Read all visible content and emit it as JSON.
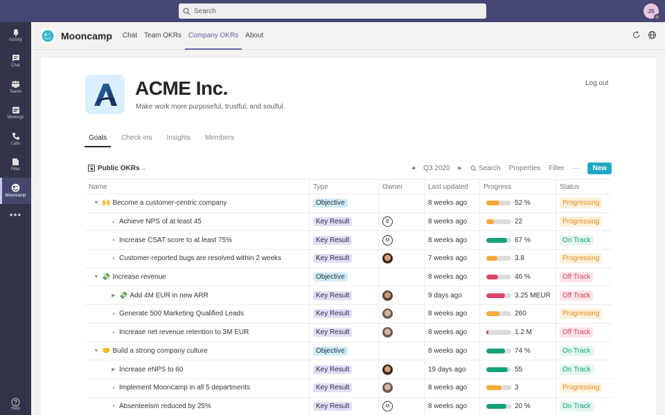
{
  "topbar": {
    "search_placeholder": "Search",
    "user_initials": "JS"
  },
  "rail": {
    "items": [
      {
        "label": "Activity",
        "icon": "bell-icon"
      },
      {
        "label": "Chat",
        "icon": "chat-icon"
      },
      {
        "label": "Teams",
        "icon": "teams-icon"
      },
      {
        "label": "Meetings",
        "icon": "calendar-icon"
      },
      {
        "label": "Calls",
        "icon": "phone-icon"
      },
      {
        "label": "Files",
        "icon": "file-icon"
      },
      {
        "label": "Mooncamp",
        "icon": "mooncamp-icon",
        "active": true
      }
    ],
    "more_label": "•••",
    "help_label": "Help"
  },
  "appbar": {
    "app_name": "Mooncamp",
    "tabs": [
      "Chat",
      "Team OKRs",
      "Company OKRs",
      "About"
    ],
    "active_tab": "Company OKRs"
  },
  "org": {
    "name": "ACME Inc.",
    "tagline": "Make work more purposeful, trustful, and soulful.",
    "logout_label": "Log out"
  },
  "tabs": [
    "Goals",
    "Check-ins",
    "Insights",
    "Members"
  ],
  "active_tab": "Goals",
  "toolbar": {
    "view_label": "Public OKRs",
    "period": "Q3 2020",
    "search_label": "Search",
    "properties_label": "Properties",
    "filter_label": "Filter",
    "more_label": "···",
    "new_label": "New"
  },
  "table": {
    "columns": [
      "Name",
      "Type",
      "Owner",
      "Last updated",
      "Progress",
      "Status"
    ],
    "rows": [
      {
        "level": 0,
        "toggle": "expanded",
        "emoji": "🙌",
        "name": "Become a customer-centric company",
        "type": "Objective",
        "owner": null,
        "updated": "8 weeks ago",
        "progress": 0.52,
        "progress_label": "52 %",
        "status": "Progressing"
      },
      {
        "level": 1,
        "toggle": "bullet",
        "emoji": "",
        "name": "Achieve NPS of at least 45",
        "type": "Key Result",
        "owner": {
          "kind": "initial",
          "value": "B"
        },
        "updated": "8 weeks ago",
        "progress": 0.3,
        "progress_label": "22",
        "status": "Progressing"
      },
      {
        "level": 1,
        "toggle": "bullet",
        "emoji": "",
        "name": "Increase CSAT score to at least 75%",
        "type": "Key Result",
        "owner": {
          "kind": "initial",
          "value": "M"
        },
        "updated": "8 weeks ago",
        "progress": 0.82,
        "progress_label": "67 %",
        "status": "On Track"
      },
      {
        "level": 1,
        "toggle": "bullet",
        "emoji": "",
        "name": "Customer-reported bugs are resolved within 2 weeks",
        "type": "Key Result",
        "owner": {
          "kind": "photo",
          "value": "woman"
        },
        "updated": "7 weeks ago",
        "progress": 0.45,
        "progress_label": "3.8",
        "status": "Progressing"
      },
      {
        "level": 0,
        "toggle": "expanded",
        "emoji": "💸",
        "name": "Increase revenue",
        "type": "Objective",
        "owner": null,
        "updated": "8 weeks ago",
        "progress": 0.46,
        "progress_label": "46 %",
        "status": "Off Track"
      },
      {
        "level": 1,
        "toggle": "collapsed",
        "emoji": "💸",
        "name": "Add 4M EUR in new ARR",
        "type": "Key Result",
        "owner": {
          "kind": "photo",
          "value": "man1"
        },
        "updated": "9 days ago",
        "progress": 0.75,
        "progress_label": "3.25 MEUR",
        "status": "Off Track"
      },
      {
        "level": 1,
        "toggle": "bullet",
        "emoji": "",
        "name": "Generate 500 Marketing Qualified Leads",
        "type": "Key Result",
        "owner": {
          "kind": "photo",
          "value": "man2"
        },
        "updated": "8 weeks ago",
        "progress": 0.52,
        "progress_label": "260",
        "status": "Progressing"
      },
      {
        "level": 1,
        "toggle": "bullet",
        "emoji": "",
        "name": "Increase net revenue retention to 3M EUR",
        "type": "Key Result",
        "owner": {
          "kind": "photo",
          "value": "man2"
        },
        "updated": "8 weeks ago",
        "progress": 0.08,
        "progress_label": "1.2 M",
        "status": "Off Track"
      },
      {
        "level": 0,
        "toggle": "expanded",
        "emoji": "🤝",
        "name": "Build a strong company culture",
        "type": "Objective",
        "owner": null,
        "updated": "8 weeks ago",
        "progress": 0.74,
        "progress_label": "74 %",
        "status": "On Track"
      },
      {
        "level": 1,
        "toggle": "collapsed",
        "emoji": "",
        "name": "Increase eNPS to 60",
        "type": "Key Result",
        "owner": {
          "kind": "photo",
          "value": "woman"
        },
        "updated": "19 days ago",
        "progress": 0.85,
        "progress_label": "55",
        "status": "On Track"
      },
      {
        "level": 1,
        "toggle": "bullet",
        "emoji": "",
        "name": "Implement Mooncamp in all 5 departments",
        "type": "Key Result",
        "owner": {
          "kind": "photo",
          "value": "man2"
        },
        "updated": "8 weeks ago",
        "progress": 0.6,
        "progress_label": "3",
        "status": "Progressing"
      },
      {
        "level": 1,
        "toggle": "bullet",
        "emoji": "",
        "name": "Absenteeism reduced by 25%",
        "type": "Key Result",
        "owner": {
          "kind": "initial",
          "value": "M"
        },
        "updated": "8 weeks ago",
        "progress": 0.8,
        "progress_label": "20 %",
        "status": "On Track"
      }
    ]
  },
  "colors": {
    "accent": "#6264a7",
    "progressing": "#f8a93b",
    "on_track": "#13a07c",
    "off_track": "#dd4766",
    "new_button": "#1fa6c5"
  }
}
